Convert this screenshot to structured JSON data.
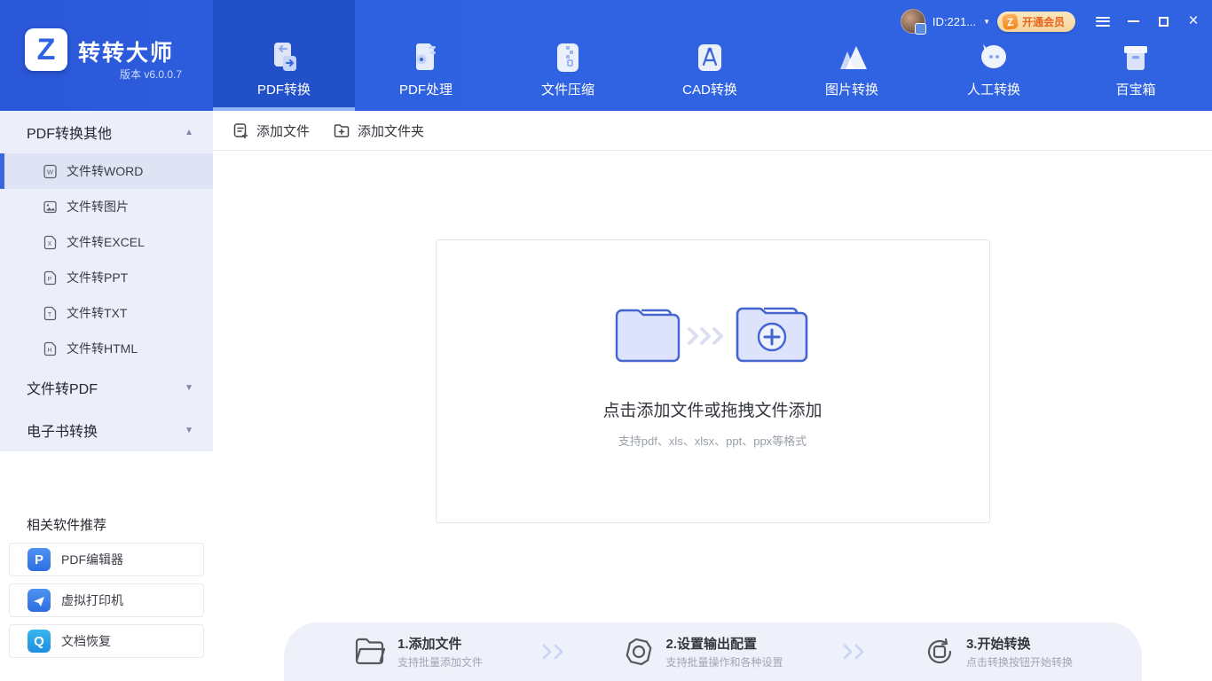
{
  "app": {
    "logo_letter": "Z",
    "title": "转转大师",
    "version": "版本 v6.0.0.7"
  },
  "titlebar": {
    "user_id": "ID:221...",
    "caret": "▼",
    "vip": {
      "z": "Z",
      "label": "开通会员"
    },
    "close_glyph": "×"
  },
  "nav": {
    "items": [
      {
        "label": "PDF转换",
        "active": true
      },
      {
        "label": "PDF处理",
        "active": false
      },
      {
        "label": "文件压缩",
        "active": false
      },
      {
        "label": "CAD转换",
        "active": false
      },
      {
        "label": "图片转换",
        "active": false
      },
      {
        "label": "人工转换",
        "active": false
      },
      {
        "label": "百宝箱",
        "active": false
      }
    ]
  },
  "sidebar": {
    "sections": [
      {
        "label": "PDF转换其他",
        "arrow": "▲",
        "items": [
          {
            "label": "文件转WORD",
            "glyph": "W",
            "selected": true
          },
          {
            "label": "文件转图片",
            "glyph": "",
            "selected": false
          },
          {
            "label": "文件转EXCEL",
            "glyph": "X",
            "selected": false
          },
          {
            "label": "文件转PPT",
            "glyph": "P",
            "selected": false
          },
          {
            "label": "文件转TXT",
            "glyph": "T",
            "selected": false
          },
          {
            "label": "文件转HTML",
            "glyph": "H",
            "selected": false
          }
        ]
      },
      {
        "label": "文件转PDF",
        "arrow": "▼"
      },
      {
        "label": "电子书转换",
        "arrow": "▼"
      }
    ],
    "recommend": {
      "title": "相关软件推荐",
      "items": [
        {
          "label": "PDF编辑器",
          "icon_letter": "P"
        },
        {
          "label": "虚拟打印机",
          "icon_letter": ""
        },
        {
          "label": "文档恢复",
          "icon_letter": "Q"
        }
      ]
    }
  },
  "toolbar": {
    "add_file": "添加文件",
    "add_folder": "添加文件夹"
  },
  "dropzone": {
    "title": "点击添加文件或拖拽文件添加",
    "subtitle": "支持pdf、xls、xlsx、ppt、ppx等格式"
  },
  "steps": [
    {
      "title": "1.添加文件",
      "subtitle": "支持批量添加文件"
    },
    {
      "title": "2.设置输出配置",
      "subtitle": "支持批量操作和各种设置"
    },
    {
      "title": "3.开始转换",
      "subtitle": "点击转换按钮开始转换"
    }
  ],
  "colors": {
    "header_blue": "#2f63e2",
    "header_blue_dark": "#2a57d8",
    "active_tab": "#2150c8",
    "tab_underline": "#8fb2f4",
    "accent": "#3a67de",
    "lavender": "#eceefa",
    "selected_item": "#dfe4f5",
    "badge_bg": "#f5d39a",
    "badge_text": "#e8641c",
    "steps_bg": "#eff1fa",
    "illustration_fill": "#dce3fa",
    "illustration_stroke": "#4465cf"
  }
}
